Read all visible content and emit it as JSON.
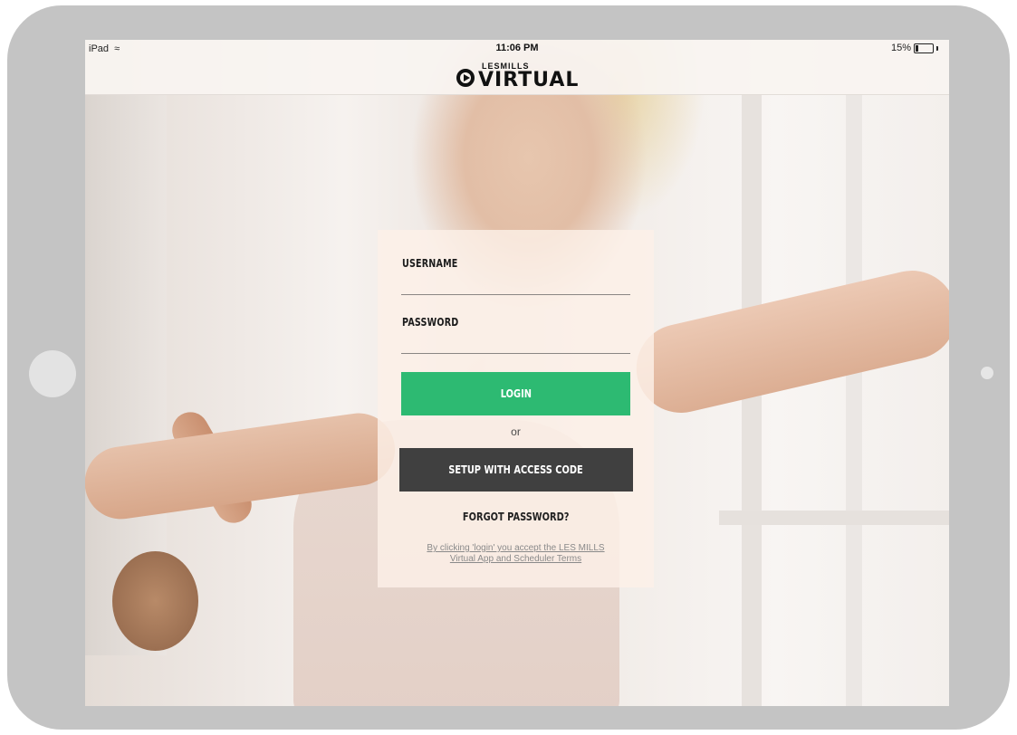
{
  "status_bar": {
    "carrier": "iPad",
    "time": "11:06 PM",
    "battery_percent": "15%",
    "battery_level": 0.15,
    "wifi_icon": "wifi-icon"
  },
  "brand": {
    "small": "LESMILLS",
    "big": "VIRTUAL",
    "icon": "play-circle-icon"
  },
  "login": {
    "username_label": "USERNAME",
    "username_value": "",
    "password_label": "PASSWORD",
    "password_value": "",
    "login_button": "LOGIN",
    "or_text": "or",
    "access_code_button": "SETUP WITH ACCESS CODE",
    "forgot_password": "FORGOT PASSWORD?",
    "terms_line1": "By clicking 'login' you accept the LES MILLS",
    "terms_line2": "Virtual App and Scheduler Terms"
  },
  "colors": {
    "login_button": "#2dba72",
    "access_button": "#404040",
    "device_frame": "#c4c4c4"
  }
}
